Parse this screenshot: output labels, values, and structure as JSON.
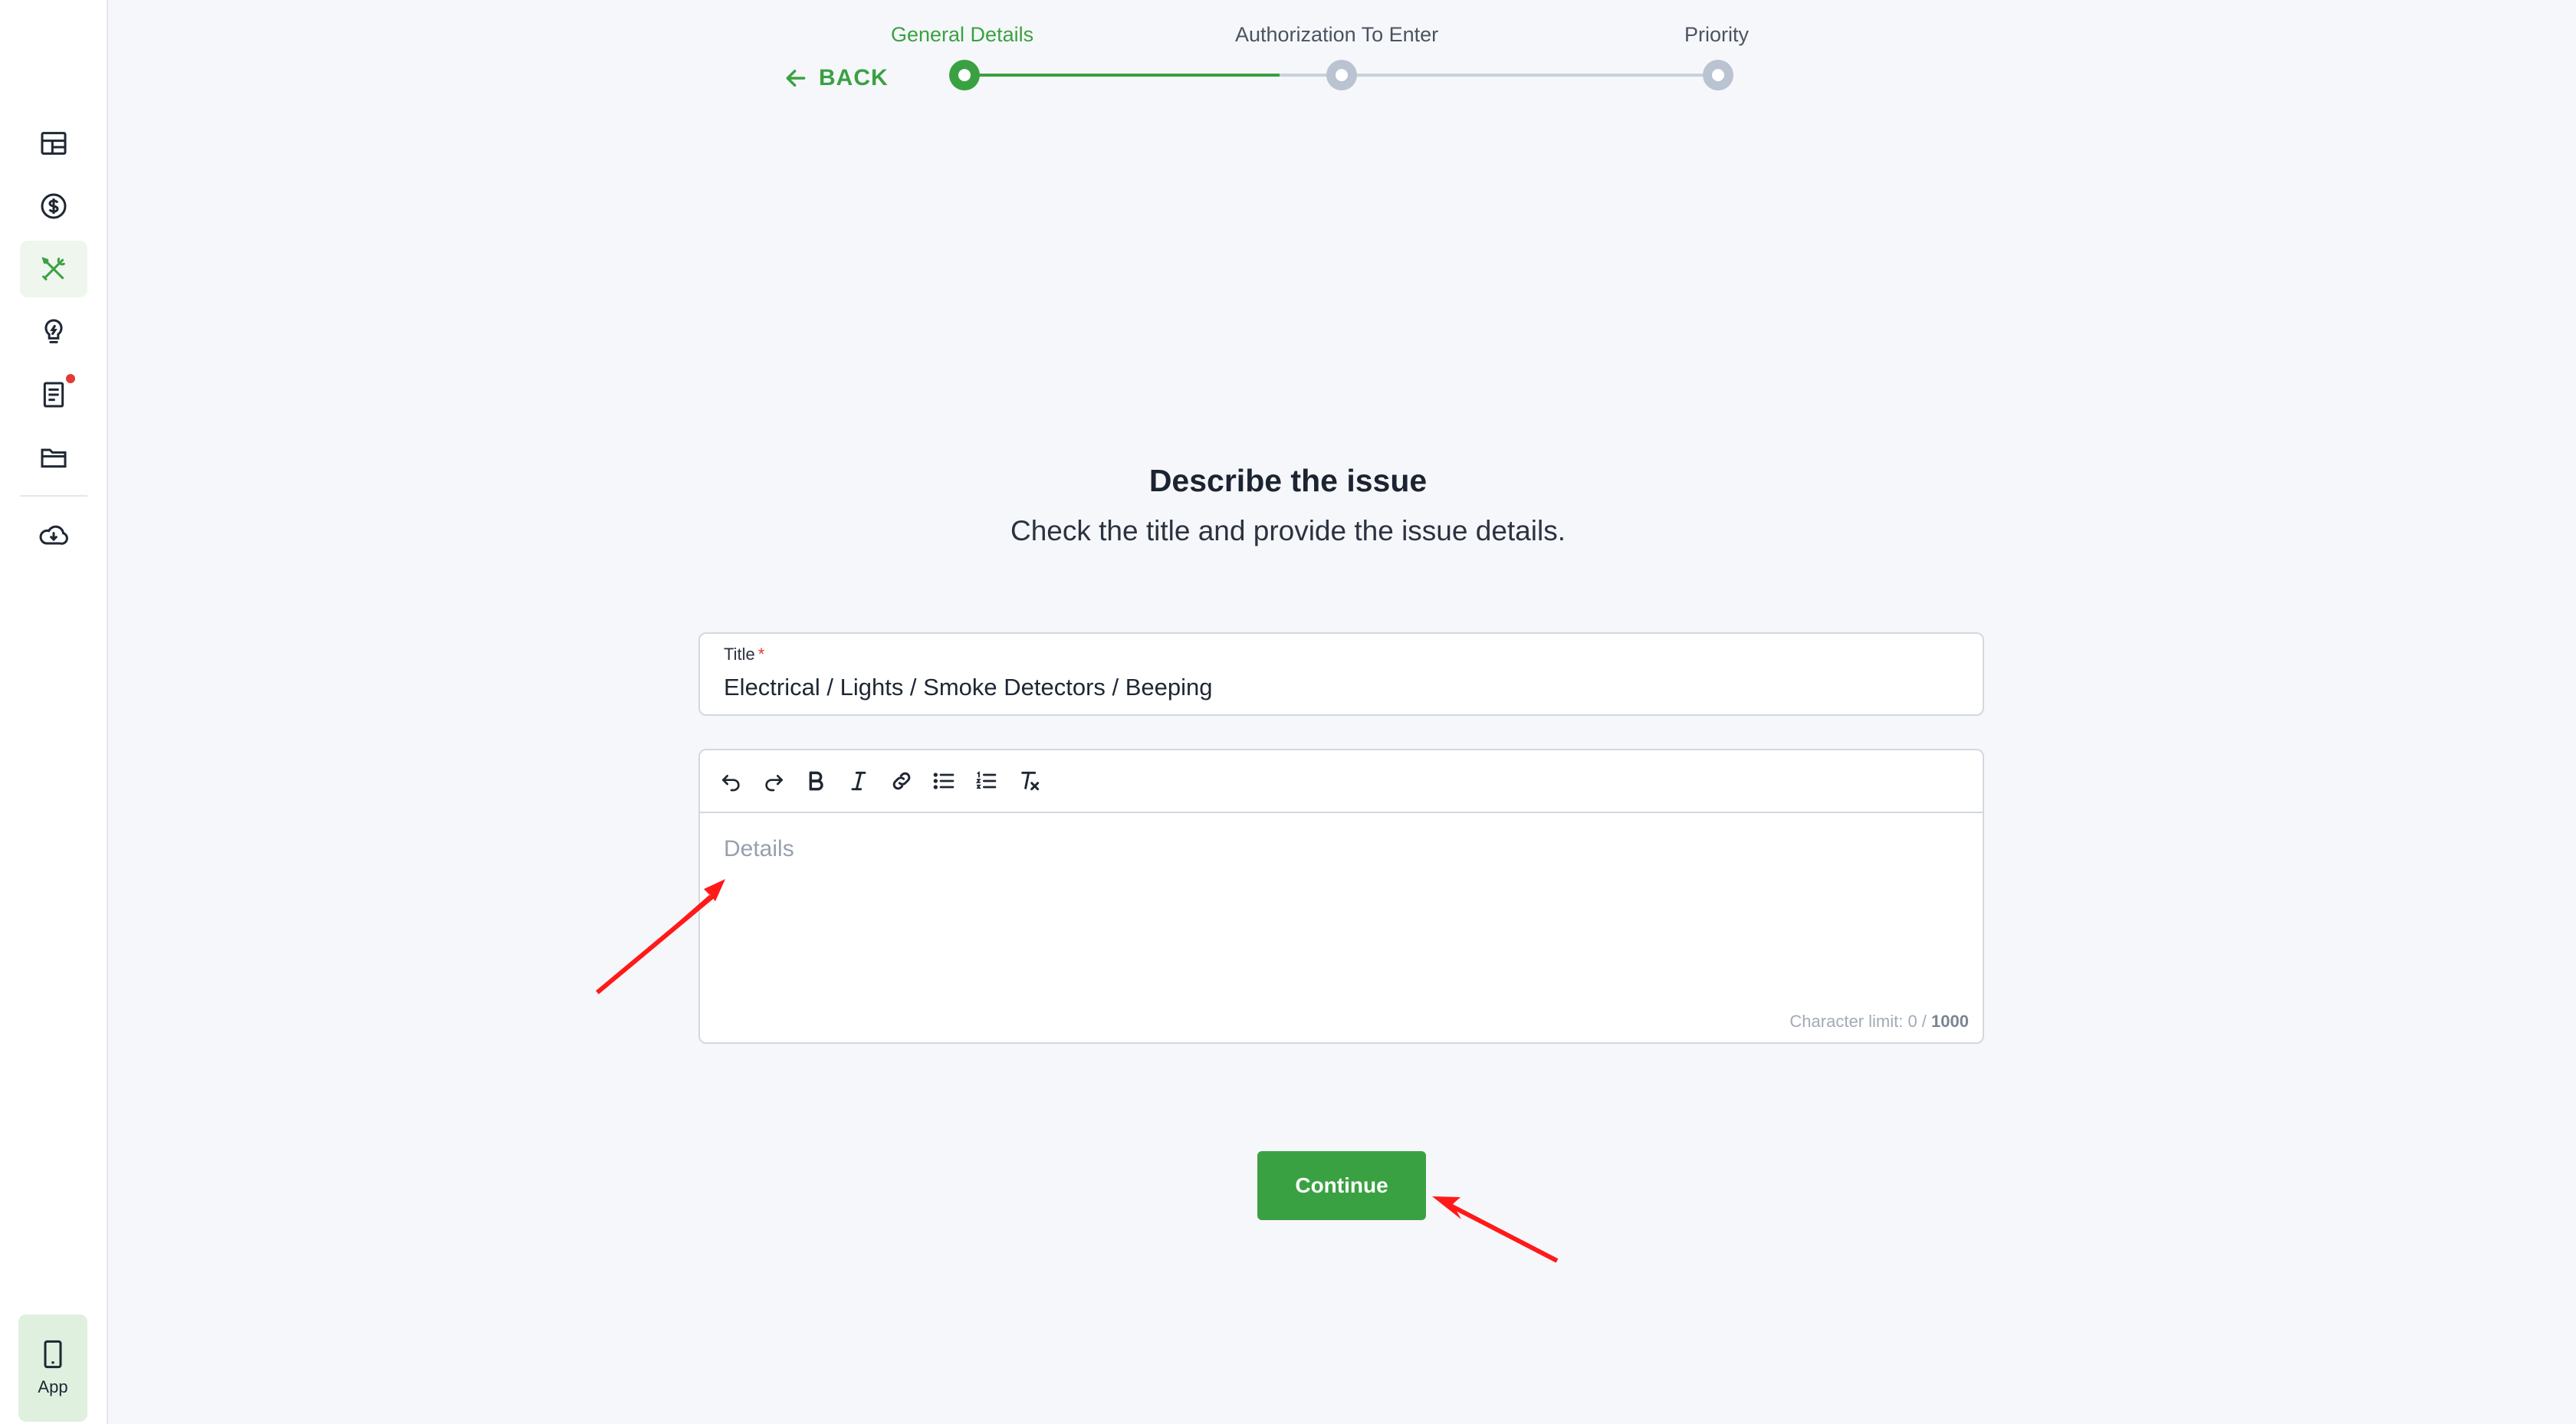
{
  "sidebar": {
    "items": [
      {
        "name": "dashboard",
        "active": false
      },
      {
        "name": "payments",
        "active": false
      },
      {
        "name": "maintenance",
        "active": true
      },
      {
        "name": "ideas",
        "active": false
      },
      {
        "name": "documents",
        "active": false,
        "badge": true
      },
      {
        "name": "files",
        "active": false
      },
      {
        "name": "downloads",
        "active": false
      }
    ],
    "app_label": "App"
  },
  "stepper": {
    "back_label": "BACK",
    "steps": [
      {
        "label": "General Details",
        "state": "active"
      },
      {
        "label": "Authorization To Enter",
        "state": "inactive"
      },
      {
        "label": "Priority",
        "state": "inactive"
      }
    ],
    "active_color": "#3aa142",
    "inactive_color": "#b9c3d1"
  },
  "main": {
    "title": "Describe the issue",
    "subtitle": "Check the title and provide the issue details.",
    "title_field": {
      "label": "Title",
      "required_marker": "*",
      "value": "Electrical / Lights / Smoke Detectors / Beeping"
    },
    "editor": {
      "toolbar": [
        "undo-icon",
        "redo-icon",
        "bold-icon",
        "italic-icon",
        "link-icon",
        "bullet-list-icon",
        "numbered-list-icon",
        "clear-format-icon"
      ],
      "placeholder": "Details",
      "char_limit_label": "Character limit: 0 /",
      "char_limit_max": "1000"
    },
    "continue_label": "Continue"
  },
  "annotations": {
    "arrow_color": "#ff1a1a"
  }
}
